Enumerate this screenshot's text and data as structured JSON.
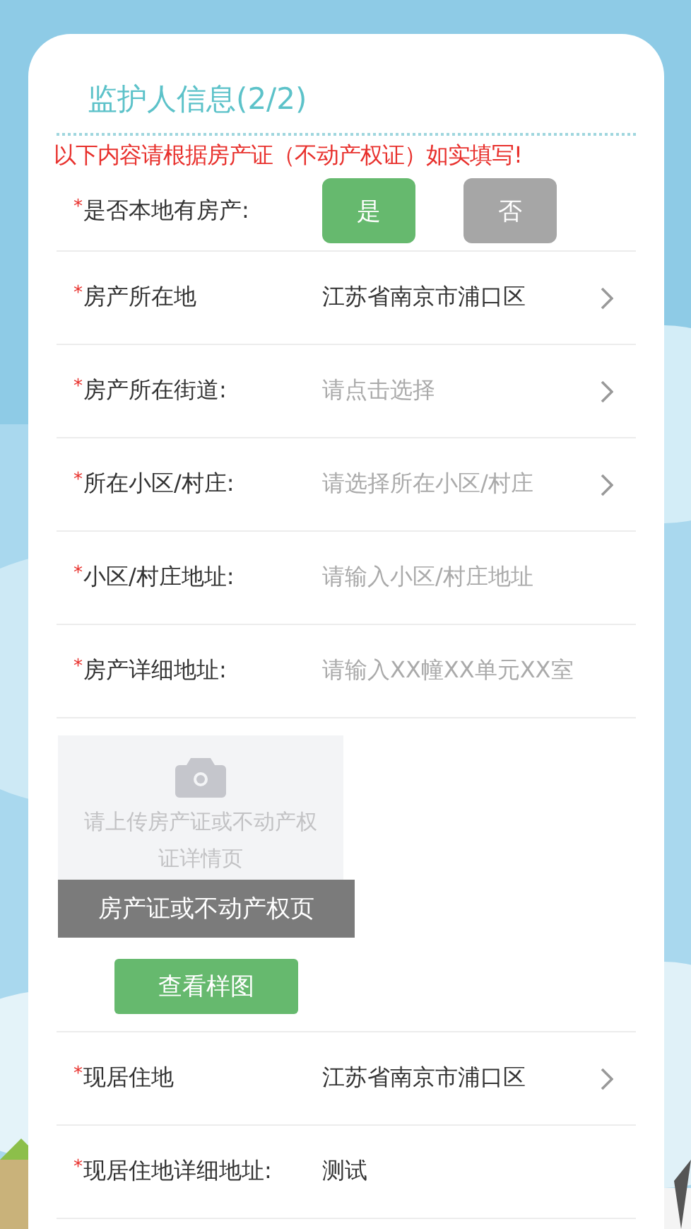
{
  "title": "监护人信息(2/2)",
  "notice": "以下内容请根据房产证（不动产权证）如实填写!",
  "fields": [
    {
      "kind": "choice",
      "mark": "*",
      "label": "是否本地有房产:",
      "options": [
        {
          "label": "是",
          "selected": true
        },
        {
          "label": "否",
          "selected": false
        }
      ]
    },
    {
      "kind": "select",
      "mark": "*",
      "label": "房产所在地",
      "value": "江苏省南京市浦口区"
    },
    {
      "kind": "select",
      "mark": "*",
      "label": "房产所在街道:",
      "placeholder": "请点击选择"
    },
    {
      "kind": "select",
      "mark": "*",
      "label": "所在小区/村庄:",
      "placeholder": "请选择所在小区/村庄"
    },
    {
      "kind": "input",
      "mark": "*",
      "label": "小区/村庄地址:",
      "placeholder": "请输入小区/村庄地址"
    },
    {
      "kind": "input",
      "mark": "*",
      "label": "房产详细地址:",
      "placeholder": "请输入XX幢XX单元XX室"
    },
    {
      "kind": "upload",
      "hint": "请上传房产证或不动产权证详情页",
      "caption": "房产证或不动产权页",
      "button": "查看样图"
    },
    {
      "kind": "select",
      "mark": "*",
      "label": "现居住地",
      "value": "江苏省南京市浦口区"
    },
    {
      "kind": "input",
      "mark": "*",
      "label": "现居住地详细地址:",
      "value": "测试"
    }
  ]
}
